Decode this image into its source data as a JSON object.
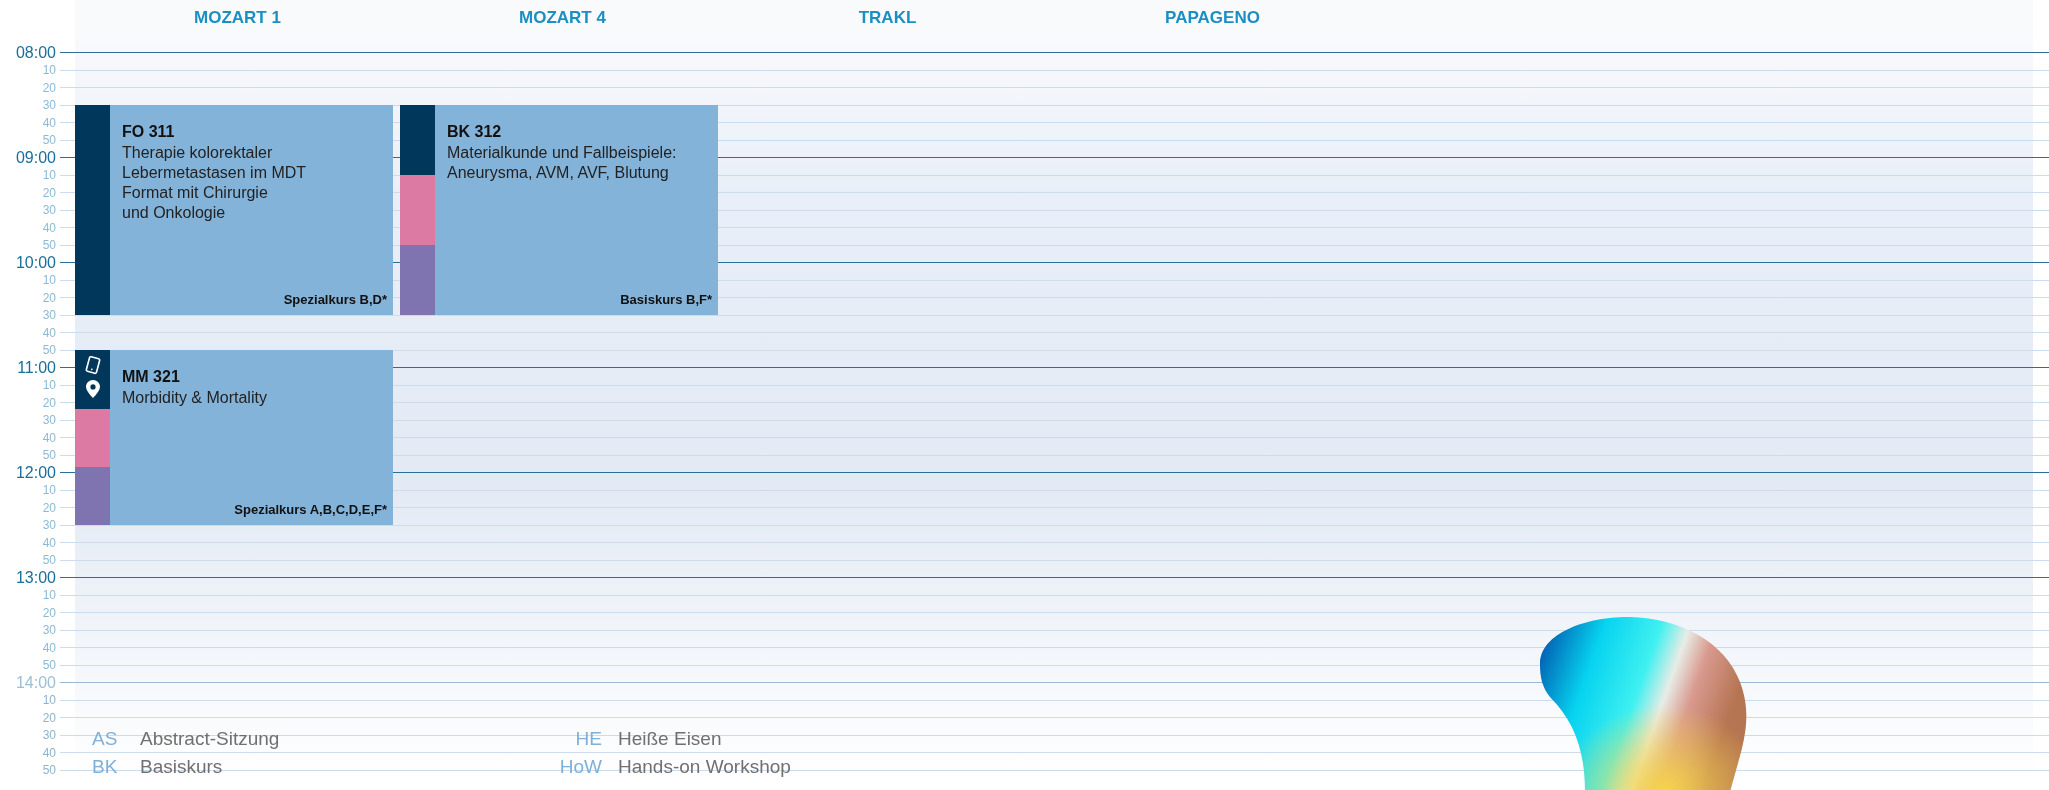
{
  "rooms": [
    {
      "name": "MOZART 1",
      "sessions": [
        {
          "code": "FO 311",
          "title": "Therapie kolorektaler\nLebermetastasen im MDT\nFormat mit Chirurgie\nund Onkologie",
          "course": "Spezialkurs B,D*",
          "strip": [
            {
              "kind": "plain",
              "color": "#00375a"
            }
          ]
        },
        {
          "code": "MM 321",
          "title": "Morbidity & Mortality",
          "course": "Spezialkurs A,B,C,D,E,F*",
          "strip": [
            {
              "kind": "icons",
              "color": "#00375a"
            },
            {
              "kind": "plain",
              "color": "#dc7aa3"
            },
            {
              "kind": "plain",
              "color": "#7f74b0"
            }
          ]
        }
      ]
    },
    {
      "name": "MOZART 4",
      "sessions": [
        {
          "code": "BK 312",
          "title": "Materialkunde und Fallbeispiele:\nAneurysma, AVM, AVF, Blutung",
          "course": "Basiskurs B,F*",
          "strip": [
            {
              "kind": "plain",
              "color": "#00375a"
            },
            {
              "kind": "plain",
              "color": "#dc7aa3"
            },
            {
              "kind": "plain",
              "color": "#7f74b0"
            }
          ]
        }
      ]
    },
    {
      "name": "TRAKL"
    },
    {
      "name": "PAPAGENO"
    }
  ],
  "time_labels": [
    {
      "text": "08:00",
      "kind": "hour"
    },
    {
      "text": "10",
      "kind": "minute"
    },
    {
      "text": "20",
      "kind": "minute"
    },
    {
      "text": "30",
      "kind": "minute"
    },
    {
      "text": "40",
      "kind": "minute"
    },
    {
      "text": "50",
      "kind": "minute"
    },
    {
      "text": "09:00",
      "kind": "hour"
    },
    {
      "text": "10",
      "kind": "minute"
    },
    {
      "text": "20",
      "kind": "minute"
    },
    {
      "text": "30",
      "kind": "minute"
    },
    {
      "text": "40",
      "kind": "minute"
    },
    {
      "text": "50",
      "kind": "minute"
    },
    {
      "text": "10:00",
      "kind": "hour"
    },
    {
      "text": "10",
      "kind": "minute"
    },
    {
      "text": "20",
      "kind": "minute"
    },
    {
      "text": "30",
      "kind": "minute"
    },
    {
      "text": "40",
      "kind": "minute"
    },
    {
      "text": "50",
      "kind": "minute"
    },
    {
      "text": "11:00",
      "kind": "hour"
    },
    {
      "text": "10",
      "kind": "minute"
    },
    {
      "text": "20",
      "kind": "minute"
    },
    {
      "text": "30",
      "kind": "minute"
    },
    {
      "text": "40",
      "kind": "minute"
    },
    {
      "text": "50",
      "kind": "minute"
    },
    {
      "text": "12:00",
      "kind": "hour"
    },
    {
      "text": "10",
      "kind": "minute"
    },
    {
      "text": "20",
      "kind": "minute"
    },
    {
      "text": "30",
      "kind": "minute"
    },
    {
      "text": "40",
      "kind": "minute"
    },
    {
      "text": "50",
      "kind": "minute"
    },
    {
      "text": "13:00",
      "kind": "hour"
    },
    {
      "text": "10",
      "kind": "minute"
    },
    {
      "text": "20",
      "kind": "minute"
    },
    {
      "text": "30",
      "kind": "minute"
    },
    {
      "text": "40",
      "kind": "minute"
    },
    {
      "text": "50",
      "kind": "minute"
    },
    {
      "text": "14:00",
      "kind": "hour"
    },
    {
      "text": "10",
      "kind": "minute"
    },
    {
      "text": "20",
      "kind": "minute"
    },
    {
      "text": "30",
      "kind": "minute"
    },
    {
      "text": "40",
      "kind": "minute"
    },
    {
      "text": "50",
      "kind": "minute"
    }
  ],
  "legend": [
    {
      "abbr": "AS",
      "label": "Abstract-Sitzung"
    },
    {
      "abbr": "HE",
      "label": "Heiße Eisen"
    },
    {
      "abbr": "BK",
      "label": "Basiskurs"
    },
    {
      "abbr": "HoW",
      "label": "Hands-on Workshop"
    }
  ]
}
